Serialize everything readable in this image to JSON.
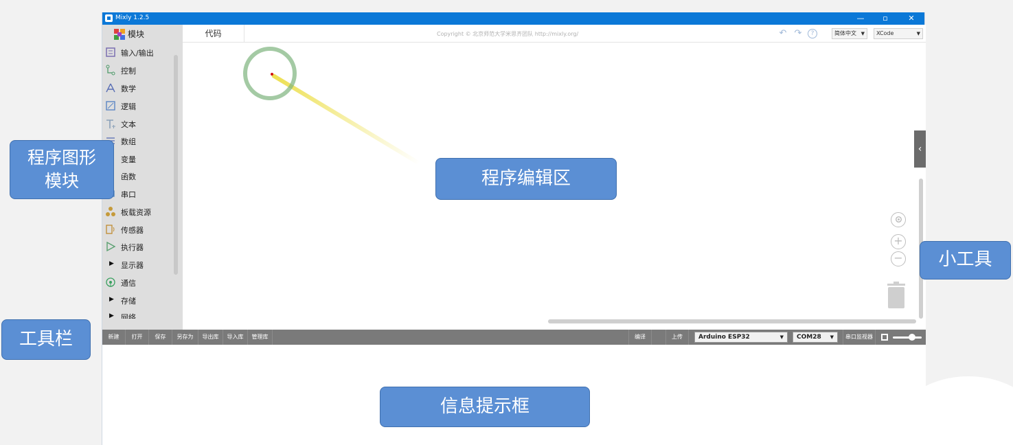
{
  "window": {
    "title": "Mixly 1.2.5",
    "controls": [
      "—",
      "▫",
      "✕"
    ]
  },
  "sidebar": {
    "header_label": "模块",
    "items": [
      {
        "label": "输入/输出",
        "icon": "io-icon",
        "color": "#7a6fb0"
      },
      {
        "label": "控制",
        "icon": "control-icon",
        "color": "#4e9a6a"
      },
      {
        "label": "数学",
        "icon": "math-icon",
        "color": "#5a6fb5"
      },
      {
        "label": "逻辑",
        "icon": "logic-icon",
        "color": "#5a86c5"
      },
      {
        "label": "文本",
        "icon": "text-icon",
        "color": "#8aa0b8"
      },
      {
        "label": "数组",
        "icon": "array-icon",
        "color": "#6a7db8"
      },
      {
        "label": "变量",
        "icon": "variable-icon",
        "color": "#a05090"
      },
      {
        "label": "函数",
        "icon": "function-icon",
        "color": "#8a6fb0"
      },
      {
        "label": "串口",
        "icon": "serial-icon",
        "color": "#4a84c4"
      },
      {
        "label": "板载资源",
        "icon": "board-icon",
        "color": "#c59a3a"
      },
      {
        "label": "传感器",
        "icon": "sensor-icon",
        "color": "#c08a30"
      },
      {
        "label": "执行器",
        "icon": "actuator-icon",
        "color": "#5aa070"
      },
      {
        "label": "显示器",
        "icon": "expand-triangle-icon",
        "color": "#111111"
      },
      {
        "label": "通信",
        "icon": "wifi-icon",
        "color": "#3aa060"
      },
      {
        "label": "存储",
        "icon": "expand-triangle-icon",
        "color": "#111111"
      },
      {
        "label": "网络",
        "icon": "expand-triangle-icon",
        "color": "#111111"
      }
    ]
  },
  "topbar": {
    "tab_code": "代码",
    "copyright": "Copyright © 北京师范大学米思齐团队 http://mixly.org/",
    "language": "简体中文",
    "theme": "XCode"
  },
  "toolbar": {
    "buttons": [
      "新建",
      "打开",
      "保存",
      "另存为",
      "导出库",
      "导入库",
      "管理库"
    ],
    "compile": "编译",
    "upload": "上传",
    "board": "Arduino ESP32",
    "port": "COM28",
    "serial_monitor": "串口监视器"
  },
  "annotations": {
    "blocks": "程序图形\n模块",
    "editor": "程序编辑区",
    "tools": "小工具",
    "toolbar": "工具栏",
    "messages": "信息提示框"
  },
  "colors": {
    "titlebar": "#0b78d7",
    "callout": "#5b8fd4",
    "toolbar": "#7a7a7a",
    "sidebar": "#dedede"
  }
}
